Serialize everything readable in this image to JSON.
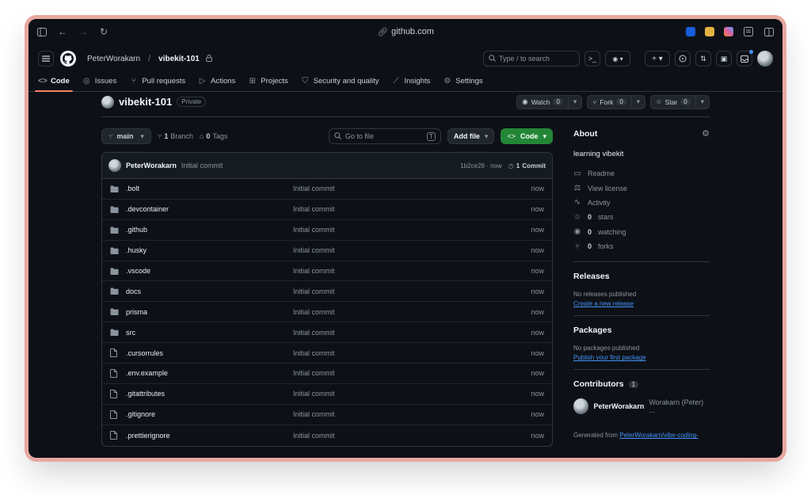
{
  "browser": {
    "url": "github.com"
  },
  "header": {
    "owner": "PeterWorakarn",
    "repo": "vibekit-101",
    "search_placeholder": "Type / to search",
    "search_key": "/"
  },
  "nav": {
    "tabs": [
      {
        "label": "Code",
        "icon": "code-icon",
        "active": true
      },
      {
        "label": "Issues",
        "icon": "issue-icon"
      },
      {
        "label": "Pull requests",
        "icon": "pull-request-icon"
      },
      {
        "label": "Actions",
        "icon": "play-icon"
      },
      {
        "label": "Projects",
        "icon": "table-icon"
      },
      {
        "label": "Security and quality",
        "icon": "shield-icon"
      },
      {
        "label": "Insights",
        "icon": "graph-icon"
      },
      {
        "label": "Settings",
        "icon": "gear-icon"
      }
    ]
  },
  "repo": {
    "name": "vibekit-101",
    "visibility": "Private",
    "watch_label": "Watch",
    "watch_count": "0",
    "fork_label": "Fork",
    "fork_count": "0",
    "star_label": "Star",
    "star_count": "0"
  },
  "toolbar": {
    "branch": "main",
    "branch_count": "1",
    "branch_label": "Branch",
    "tag_count": "0",
    "tag_label": "Tags",
    "goto_placeholder": "Go to file",
    "goto_key": "T",
    "add_file": "Add file",
    "code": "Code"
  },
  "commit": {
    "author": "PeterWorakarn",
    "message": "Initial commit",
    "hash_time": "1b2ce28 · now",
    "count": "1",
    "count_label": "Commit"
  },
  "files": [
    {
      "name": ".bolt",
      "type": "folder",
      "message": "Initial commit",
      "date": "now"
    },
    {
      "name": ".devcontainer",
      "type": "folder",
      "message": "Initial commit",
      "date": "now"
    },
    {
      "name": ".github",
      "type": "folder",
      "message": "Initial commit",
      "date": "now"
    },
    {
      "name": ".husky",
      "type": "folder",
      "message": "Initial commit",
      "date": "now"
    },
    {
      "name": ".vscode",
      "type": "folder",
      "message": "Initial commit",
      "date": "now"
    },
    {
      "name": "docs",
      "type": "folder",
      "message": "Initial commit",
      "date": "now"
    },
    {
      "name": "prisma",
      "type": "folder",
      "message": "Initial commit",
      "date": "now"
    },
    {
      "name": "src",
      "type": "folder",
      "message": "Initial commit",
      "date": "now"
    },
    {
      "name": ".cursorrules",
      "type": "file",
      "message": "Initial commit",
      "date": "now"
    },
    {
      "name": ".env.example",
      "type": "file",
      "message": "Initial commit",
      "date": "now"
    },
    {
      "name": ".gitattributes",
      "type": "file",
      "message": "Initial commit",
      "date": "now"
    },
    {
      "name": ".gitignore",
      "type": "file",
      "message": "Initial commit",
      "date": "now"
    },
    {
      "name": ".prettierignore",
      "type": "file",
      "message": "Initial commit",
      "date": "now"
    }
  ],
  "about": {
    "title": "About",
    "description": "learning vibekit",
    "links": [
      {
        "icon": "book-icon",
        "label": "Readme"
      },
      {
        "icon": "law-icon",
        "label": "View license"
      },
      {
        "icon": "pulse-icon",
        "label": "Activity"
      },
      {
        "icon": "star-icon",
        "label": "stars",
        "count": "0"
      },
      {
        "icon": "eye-icon",
        "label": "watching",
        "count": "0"
      },
      {
        "icon": "fork-icon",
        "label": "forks",
        "count": "0"
      }
    ]
  },
  "releases": {
    "title": "Releases",
    "empty": "No releases published",
    "link": "Create a new release"
  },
  "packages": {
    "title": "Packages",
    "empty": "No packages published",
    "link": "Publish your first package"
  },
  "contributors": {
    "title": "Contributors",
    "count": "1",
    "name": "PeterWorakarn",
    "fullname": "Worakarn (Peter) ..."
  },
  "generated": {
    "prefix": "Generated from",
    "link": "PeterWorakarn/vibe-coding-"
  },
  "colors": {
    "accent_tab": "#f78166",
    "green": "#238636",
    "link": "#4493f8",
    "bg": "#0d1117"
  }
}
